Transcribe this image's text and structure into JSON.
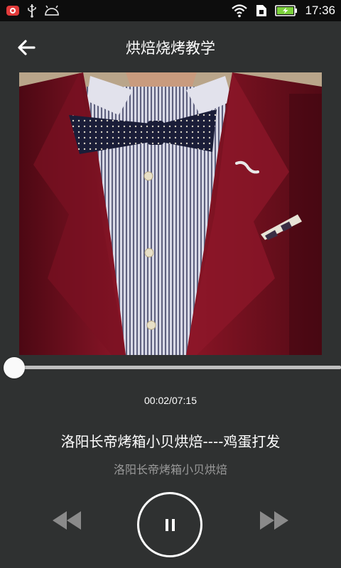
{
  "status_bar": {
    "time": "17:36",
    "left_icons": [
      "notification-app-icon",
      "usb-icon",
      "android-debug-icon"
    ],
    "right_icons": [
      "wifi-icon",
      "sim-icon",
      "battery-charging-icon"
    ]
  },
  "header": {
    "title": "烘焙烧烤教学",
    "back_icon": "arrow-left-icon"
  },
  "player": {
    "timecode": "00:02/07:15",
    "progress": 0.005,
    "track_title": "洛阳长帝烤箱小贝烘焙----鸡蛋打发",
    "track_artist": "洛阳长帝烤箱小贝烘焙",
    "controls": [
      "rewind-icon",
      "pause-icon",
      "fast-forward-icon"
    ]
  },
  "colors": {
    "background": "#2f3131",
    "status_bar": "#0d0d0d",
    "subtitle_text": "#9a9a9a",
    "battery": "#7bd13b"
  }
}
